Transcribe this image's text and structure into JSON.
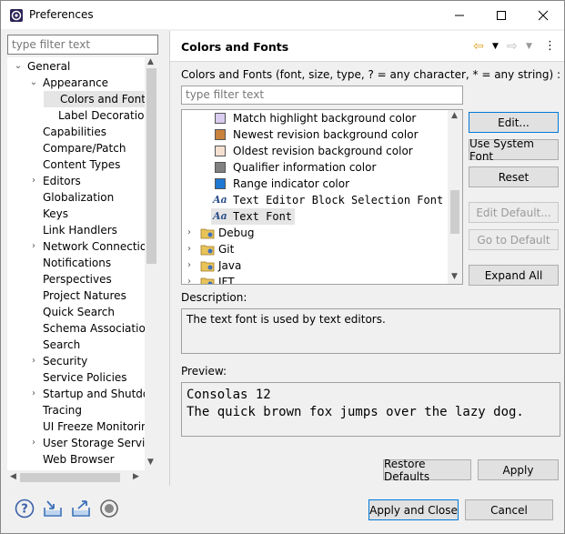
{
  "window": {
    "title": "Preferences",
    "controls": [
      "minimize",
      "maximize",
      "close"
    ]
  },
  "left": {
    "filter_placeholder": "type filter text",
    "tree": [
      {
        "label": "General",
        "level": 0,
        "chevron": "down"
      },
      {
        "label": "Appearance",
        "level": 1,
        "chevron": "down"
      },
      {
        "label": "Colors and Fonts",
        "level": 2,
        "chevron": "",
        "selected": true
      },
      {
        "label": "Label Decorations",
        "level": 2,
        "chevron": ""
      },
      {
        "label": "Capabilities",
        "level": 1,
        "chevron": ""
      },
      {
        "label": "Compare/Patch",
        "level": 1,
        "chevron": ""
      },
      {
        "label": "Content Types",
        "level": 1,
        "chevron": ""
      },
      {
        "label": "Editors",
        "level": 1,
        "chevron": "right"
      },
      {
        "label": "Globalization",
        "level": 1,
        "chevron": ""
      },
      {
        "label": "Keys",
        "level": 1,
        "chevron": ""
      },
      {
        "label": "Link Handlers",
        "level": 1,
        "chevron": ""
      },
      {
        "label": "Network Connections",
        "level": 1,
        "chevron": "right"
      },
      {
        "label": "Notifications",
        "level": 1,
        "chevron": ""
      },
      {
        "label": "Perspectives",
        "level": 1,
        "chevron": ""
      },
      {
        "label": "Project Natures",
        "level": 1,
        "chevron": ""
      },
      {
        "label": "Quick Search",
        "level": 1,
        "chevron": ""
      },
      {
        "label": "Schema Associations",
        "level": 1,
        "chevron": ""
      },
      {
        "label": "Search",
        "level": 1,
        "chevron": ""
      },
      {
        "label": "Security",
        "level": 1,
        "chevron": "right"
      },
      {
        "label": "Service Policies",
        "level": 1,
        "chevron": ""
      },
      {
        "label": "Startup and Shutdown",
        "level": 1,
        "chevron": "right"
      },
      {
        "label": "Tracing",
        "level": 1,
        "chevron": ""
      },
      {
        "label": "UI Freeze Monitoring",
        "level": 1,
        "chevron": ""
      },
      {
        "label": "User Storage Service",
        "level": 1,
        "chevron": "right"
      },
      {
        "label": "Web Browser",
        "level": 1,
        "chevron": ""
      }
    ]
  },
  "right": {
    "title": "Colors and Fonts",
    "subtitle": "Colors and Fonts (font, size, type, ? = any character, * = any string) :",
    "filter_placeholder": "type filter text",
    "items": [
      {
        "type": "color",
        "label": "Match highlight background color",
        "color": "#d9ccf0"
      },
      {
        "type": "color",
        "label": "Newest revision background color",
        "color": "#c8823c"
      },
      {
        "type": "color",
        "label": "Oldest revision background color",
        "color": "#f5e0d2"
      },
      {
        "type": "color",
        "label": "Qualifier information color",
        "color": "#808080"
      },
      {
        "type": "color",
        "label": "Range indicator color",
        "color": "#1e78d2"
      },
      {
        "type": "font",
        "label": "Text Editor Block Selection Font"
      },
      {
        "type": "font",
        "label": "Text Font",
        "selected": true
      },
      {
        "type": "category",
        "label": "Debug"
      },
      {
        "type": "category",
        "label": "Git"
      },
      {
        "type": "category",
        "label": "Java"
      },
      {
        "type": "category",
        "label": "JFT"
      }
    ],
    "buttons": {
      "edit": "Edit...",
      "use_system_font": "Use System Font",
      "reset": "Reset",
      "edit_default": "Edit Default...",
      "go_to_default": "Go to Default",
      "expand_all": "Expand All"
    },
    "description_label": "Description:",
    "description": "The text font is used by text editors.",
    "preview_label": "Preview:",
    "preview_line1": "Consolas 12",
    "preview_line2": "The quick brown fox jumps over the lazy dog.",
    "restore_defaults": "Restore Defaults",
    "apply": "Apply"
  },
  "footer": {
    "apply_and_close": "Apply and Close",
    "cancel": "Cancel",
    "icons": [
      "help-icon",
      "import-icon",
      "export-icon",
      "record-icon"
    ]
  }
}
